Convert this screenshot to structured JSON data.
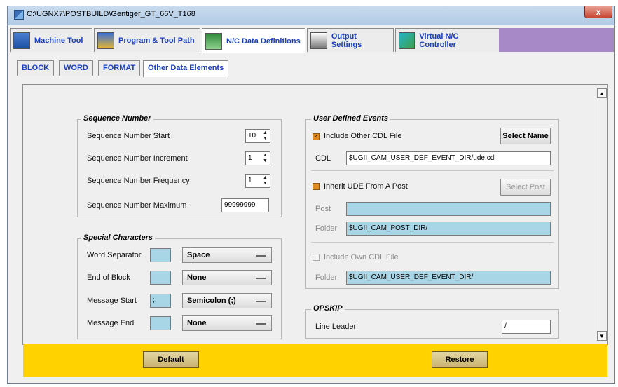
{
  "window": {
    "title": "C:\\UGNX7\\POSTBUILD\\Gentiger_GT_66V_T168",
    "close_glyph": "x"
  },
  "main_tabs": [
    {
      "label": "Machine Tool",
      "icon": "machine-tool-icon"
    },
    {
      "label": "Program & Tool Path",
      "icon": "program-icon"
    },
    {
      "label": "N/C Data Definitions",
      "icon": "nc-data-icon"
    },
    {
      "label": "Output Settings",
      "icon": "printer-icon"
    },
    {
      "label": "Virtual N/C Controller",
      "icon": "controller-icon"
    }
  ],
  "sub_tabs": [
    "BLOCK",
    "WORD",
    "FORMAT",
    "Other Data Elements"
  ],
  "sequence": {
    "title": "Sequence Number",
    "start_label": "Sequence Number Start",
    "start_value": "10",
    "increment_label": "Sequence Number Increment",
    "increment_value": "1",
    "frequency_label": "Sequence Number Frequency",
    "frequency_value": "1",
    "maximum_label": "Sequence Number Maximum",
    "maximum_value": "99999999"
  },
  "special": {
    "title": "Special Characters",
    "rows": [
      {
        "label": "Word Separator",
        "char": "",
        "option": "Space"
      },
      {
        "label": "End of Block",
        "char": "",
        "option": "None"
      },
      {
        "label": "Message Start",
        "char": ";",
        "option": "Semicolon (;)"
      },
      {
        "label": "Message End",
        "char": "",
        "option": "None"
      }
    ]
  },
  "ude": {
    "title": "User Defined Events",
    "include_other_label": "Include Other CDL File",
    "select_name_label": "Select Name",
    "cdl_label": "CDL",
    "cdl_value": "$UGII_CAM_USER_DEF_EVENT_DIR/ude.cdl",
    "inherit_label": "Inherit UDE From A Post",
    "select_post_label": "Select Post",
    "post_label": "Post",
    "post_value": "",
    "folder_label": "Folder",
    "folder_value": "$UGII_CAM_POST_DIR/",
    "include_own_label": "Include Own CDL File",
    "folder2_label": "Folder",
    "folder2_value": "$UGII_CAM_USER_DEF_EVENT_DIR/"
  },
  "opskip": {
    "title": "OPSKIP",
    "line_leader_label": "Line Leader",
    "line_leader_value": "/"
  },
  "bottom": {
    "default_label": "Default",
    "restore_label": "Restore"
  },
  "colors": {
    "tab_fill": "#a889c7",
    "bottom_bar": "#ffd200",
    "field_blue": "#a9d6e6",
    "checkbox": "#e08a1e"
  }
}
